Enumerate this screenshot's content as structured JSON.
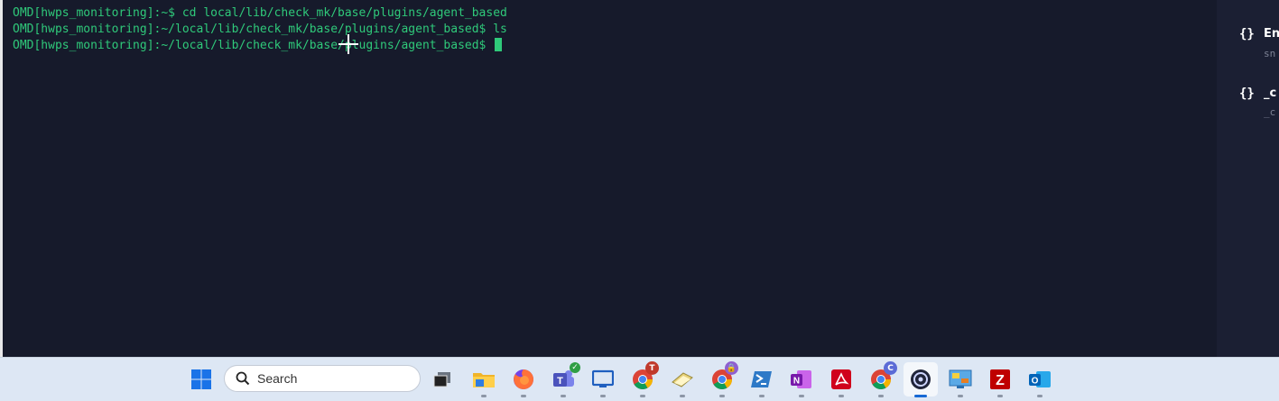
{
  "terminal": {
    "lines": [
      "OMD[hwps_monitoring]:~$ cd local/lib/check_mk/base/plugins/agent_based",
      "OMD[hwps_monitoring]:~/local/lib/check_mk/base/plugins/agent_based$ ls",
      "OMD[hwps_monitoring]:~/local/lib/check_mk/base/plugins/agent_based$ "
    ],
    "text_color": "#2fc97a",
    "background": "#161a2b"
  },
  "outline_panel": {
    "items": [
      {
        "icon": "{}",
        "title": "Ena",
        "subtitle": "sn"
      },
      {
        "icon": "{}",
        "title": "_c",
        "subtitle": "_c"
      }
    ]
  },
  "taskbar": {
    "search_placeholder": "Search",
    "apps": [
      {
        "name": "start-menu",
        "icon": "windows-logo"
      },
      {
        "name": "task-view",
        "icon": "task-view"
      },
      {
        "name": "file-explorer",
        "icon": "folder"
      },
      {
        "name": "firefox",
        "icon": "firefox"
      },
      {
        "name": "teams",
        "icon": "teams"
      },
      {
        "name": "remote-desktop",
        "icon": "monitor"
      },
      {
        "name": "chrome-profile-t",
        "icon": "chrome",
        "badge": "T"
      },
      {
        "name": "notes-app",
        "icon": "notepad"
      },
      {
        "name": "chrome-profile-lock",
        "icon": "chrome",
        "badge": "lock"
      },
      {
        "name": "powershell",
        "icon": "terminal"
      },
      {
        "name": "onenote",
        "icon": "onenote",
        "label": "N"
      },
      {
        "name": "acrobat",
        "icon": "pdf"
      },
      {
        "name": "chrome-profile-c",
        "icon": "chrome",
        "badge": "C"
      },
      {
        "name": "terminal-app",
        "icon": "terminal-round"
      },
      {
        "name": "control-panel",
        "icon": "control-panel"
      },
      {
        "name": "filezilla",
        "icon": "filezilla",
        "label": "Z"
      },
      {
        "name": "outlook",
        "icon": "outlook",
        "label": "O"
      }
    ]
  }
}
